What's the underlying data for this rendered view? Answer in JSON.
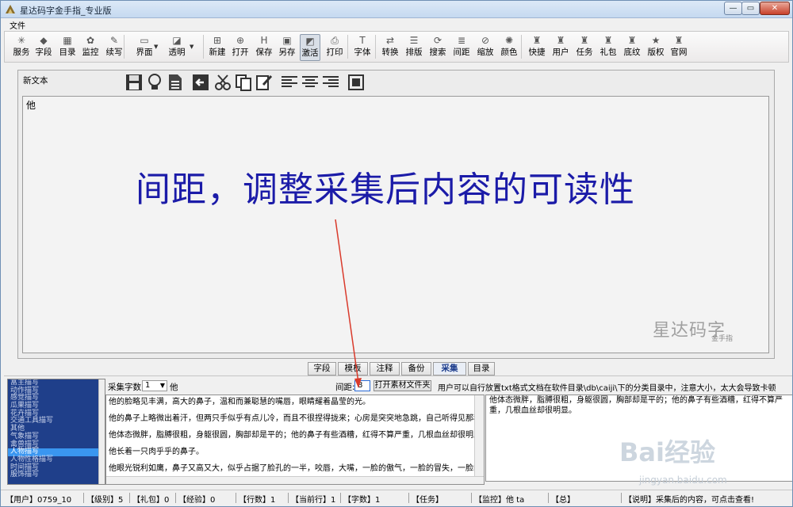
{
  "window": {
    "title": "星达码字金手指_专业版"
  },
  "menu": {
    "file": "文件"
  },
  "toolbar": [
    {
      "id": "service",
      "label": "服务",
      "icon": "service-icon",
      "glyph": "✳"
    },
    {
      "id": "fields",
      "label": "字段",
      "icon": "fields-icon",
      "glyph": "◆"
    },
    {
      "id": "catalog",
      "label": "目录",
      "icon": "catalog-icon",
      "glyph": "▦"
    },
    {
      "id": "monitor",
      "label": "监控",
      "icon": "monitor-icon",
      "glyph": "✿"
    },
    {
      "id": "continue",
      "label": "续写",
      "icon": "continue-icon",
      "glyph": "✎"
    },
    {
      "id": "ui",
      "label": "界面",
      "icon": "ui-icon",
      "glyph": "▭"
    },
    {
      "id": "transparent",
      "label": "透明",
      "icon": "transparent-icon",
      "glyph": "◪"
    },
    {
      "id": "new",
      "label": "新建",
      "icon": "new-icon",
      "glyph": "⊞"
    },
    {
      "id": "open",
      "label": "打开",
      "icon": "open-icon",
      "glyph": "⊕"
    },
    {
      "id": "save",
      "label": "保存",
      "icon": "save-icon",
      "glyph": "H"
    },
    {
      "id": "saveas",
      "label": "另存",
      "icon": "saveas-icon",
      "glyph": "▣"
    },
    {
      "id": "activate",
      "label": "激活",
      "icon": "activate-icon",
      "glyph": "◩"
    },
    {
      "id": "print",
      "label": "打印",
      "icon": "print-icon",
      "glyph": "⎙"
    },
    {
      "id": "font",
      "label": "字体",
      "icon": "font-icon",
      "glyph": "T"
    },
    {
      "id": "convert",
      "label": "转换",
      "icon": "convert-icon",
      "glyph": "⇄"
    },
    {
      "id": "layout",
      "label": "排版",
      "icon": "layout-icon",
      "glyph": "☰"
    },
    {
      "id": "search",
      "label": "搜索",
      "icon": "search-icon",
      "glyph": "⟳"
    },
    {
      "id": "spacing",
      "label": "间距",
      "icon": "spacing-icon",
      "glyph": "≣"
    },
    {
      "id": "zoom",
      "label": "缩放",
      "icon": "zoom-icon",
      "glyph": "⊘"
    },
    {
      "id": "color",
      "label": "颜色",
      "icon": "color-icon",
      "glyph": "✺"
    },
    {
      "id": "shortcut",
      "label": "快捷",
      "icon": "shortcut-icon",
      "glyph": "♜"
    },
    {
      "id": "user",
      "label": "用户",
      "icon": "user-icon",
      "glyph": "♜"
    },
    {
      "id": "task",
      "label": "任务",
      "icon": "task-icon",
      "glyph": "♜"
    },
    {
      "id": "gift",
      "label": "礼包",
      "icon": "gift-icon",
      "glyph": "♜"
    },
    {
      "id": "texture",
      "label": "底纹",
      "icon": "texture-icon",
      "glyph": "♜"
    },
    {
      "id": "copyright",
      "label": "版权",
      "icon": "copyright-icon",
      "glyph": "★"
    },
    {
      "id": "website",
      "label": "官网",
      "icon": "website-icon",
      "glyph": "♜"
    }
  ],
  "editor": {
    "doc_label": "新文本",
    "content": "他",
    "overlay_caption": "间距，调整采集后内容的可读性",
    "watermark": "星达码字",
    "watermark_sub": "金手指"
  },
  "tabs": [
    "字段",
    "模板",
    "注释",
    "备份",
    "采集",
    "目录"
  ],
  "active_tab": "采集",
  "collect": {
    "count_label": "采集字数",
    "count_value": "1",
    "keyword": "他",
    "spacing_label": "间距:",
    "spacing_value": "8",
    "open_folder_button": "打开素材文件夹",
    "hint": "用户可以自行放置txt格式文档在软件目录\\db\\caiji\\下的分类目录中，注意大小，太大会导致卡顿"
  },
  "categories": [
    "富主描写",
    "动作描写",
    "感觉描写",
    "瓜果描写",
    "花卉描写",
    "交通工具描写",
    "其他",
    "气象描写",
    "禽兽描写",
    "人物描写",
    "人物性格描写",
    "时间描写",
    "服饰描写"
  ],
  "selected_category": "人物描写",
  "source_paragraphs": [
    "他的脸略见丰满，高大的鼻子，温和而兼聪慧的嘴唇，眼睛耀着晶莹的光。",
    "他的鼻子上略微出着汗，但两只手似乎有点儿冷，而且不很捏得拢来；心房是突突地急跳，自己听得见那种不",
    "他体态微胖，脂膊很粗，身躯很圆，胸部却是平的；他的鼻子有些酒糟，红得不算严重，几根血丝却很明显。",
    "他长着一只肉乎乎的鼻子。",
    "他眼光锐利如鹰，鼻子又高又大，似乎占据了脸孔的一半，咬唇，大嘴，一脸的傲气，一脸的冒失，一脸的狠"
  ],
  "result_text": "他体态微胖，脂膊很粗，身躯很圆，胸部却是平的；他的鼻子有些酒糟，红得不算严重，几根血丝却很明显。",
  "status": [
    {
      "id": "user",
      "text": "【用户】0759_10"
    },
    {
      "id": "level",
      "text": "【级别】5"
    },
    {
      "id": "gift",
      "text": "【礼包】0"
    },
    {
      "id": "exp",
      "text": "【经验】0"
    },
    {
      "id": "lines",
      "text": "【行数】1"
    },
    {
      "id": "curline",
      "text": "【当前行】1"
    },
    {
      "id": "chars",
      "text": "【字数】1"
    },
    {
      "id": "task",
      "text": "【任务】"
    },
    {
      "id": "monitor",
      "text": "【监控】他 ta"
    },
    {
      "id": "total",
      "text": "【总】"
    },
    {
      "id": "desc",
      "text": "【说明】采集后的内容，可点击查看!"
    }
  ],
  "photo_watermark": {
    "brand": "Bai经验",
    "url": "jingyan.baidu.com"
  },
  "colors": {
    "caption": "#1b1ba8",
    "annotation_arrow": "#d93a2b",
    "list_bg": "#1f3f8a",
    "list_selected": "#3a96f0"
  }
}
